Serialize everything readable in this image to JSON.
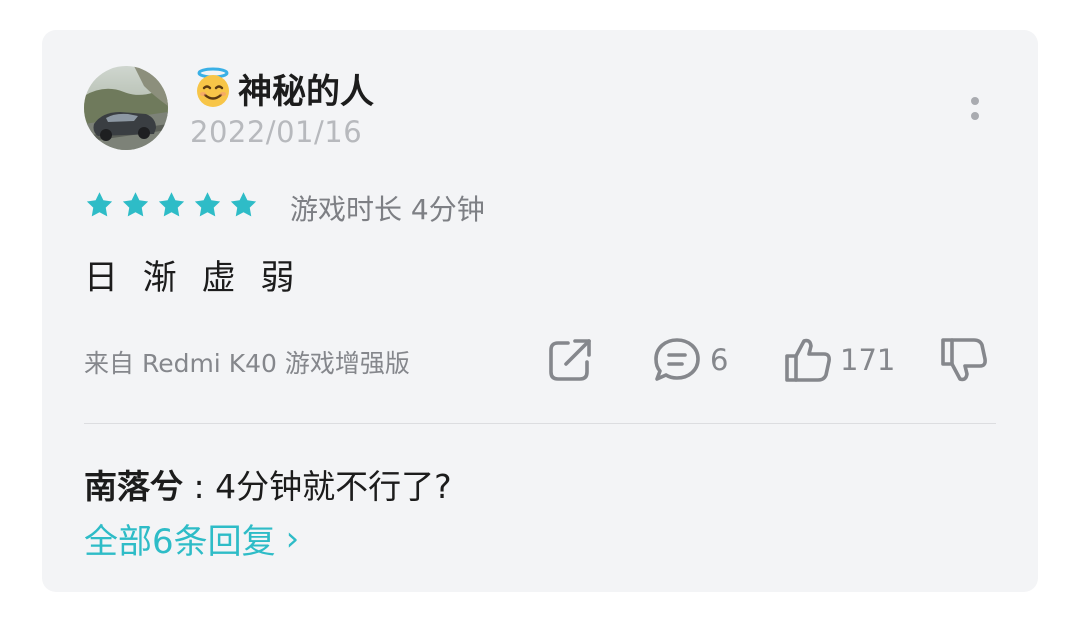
{
  "review": {
    "author": {
      "emoji": "😇",
      "name": "神秘的人"
    },
    "date": "2022/01/16",
    "rating": 5,
    "playtime": "游戏时长 4分钟",
    "content": "日 渐 虚 弱",
    "device": "来自 Redmi K40 游戏增强版",
    "actions": {
      "comment_count": "6",
      "like_count": "171"
    }
  },
  "reply": {
    "author": "南落兮",
    "separator": " : ",
    "text": "4分钟就不行了?"
  },
  "all_replies": {
    "label": "全部6条回复",
    "chevron": "›"
  },
  "icons": {
    "star": "star-icon",
    "share": "share-icon",
    "comment": "comment-icon",
    "like": "thumbs-up-icon",
    "dislike": "thumbs-down-icon",
    "more": "more-vertical-icon"
  },
  "colors": {
    "accent": "#2ebcc7",
    "card_bg": "#f3f4f6",
    "muted_text": "#85878c",
    "primary_text": "#1c1c1c"
  }
}
